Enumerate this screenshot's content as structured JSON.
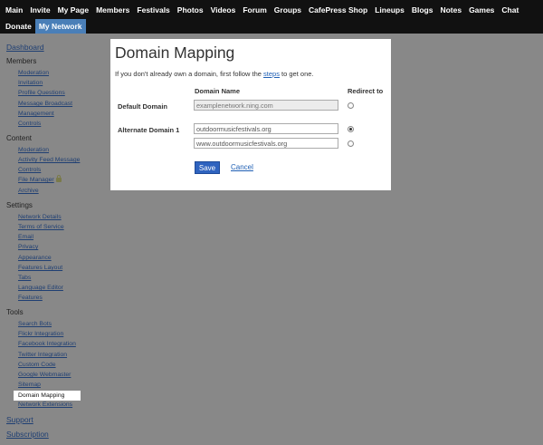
{
  "topnav": {
    "row1": [
      "Main",
      "Invite",
      "My Page",
      "Members",
      "Festivals",
      "Photos",
      "Videos",
      "Forum",
      "Groups",
      "CafePress Shop",
      "Lineups",
      "Blogs",
      "Notes",
      "Games",
      "Chat"
    ],
    "row2": [
      "Donate",
      "My Network"
    ],
    "active": "My Network"
  },
  "sidebar": {
    "dashboard": "Dashboard",
    "members": {
      "heading": "Members",
      "items": [
        "Moderation",
        "Invitation",
        "Profile Questions",
        "Message Broadcast",
        "Management",
        "Controls"
      ]
    },
    "content": {
      "heading": "Content",
      "items": [
        "Moderation",
        "Activity Feed Message",
        "Controls",
        "File Manager",
        "Archive"
      ]
    },
    "settings": {
      "heading": "Settings",
      "items": [
        "Network Details",
        "Terms of Service",
        "Email",
        "Privacy",
        "Appearance",
        "Features Layout",
        "Tabs",
        "Language Editor",
        "Features"
      ]
    },
    "tools": {
      "heading": "Tools",
      "items": [
        "Search Bots",
        "Flickr Integration",
        "Facebook Integration",
        "Twitter Integration",
        "Custom Code",
        "Google Webmaster",
        "Sitemap",
        "Domain Mapping",
        "Network Extensions"
      ],
      "selected": "Domain Mapping"
    },
    "support": "Support",
    "subscription": "Subscription"
  },
  "dialog": {
    "title": "Domain Mapping",
    "intro_before": "If you don't already own a domain, first follow the ",
    "intro_link": "steps",
    "intro_after": " to get one.",
    "col_domain": "Domain Name",
    "col_redirect": "Redirect to",
    "default_label": "Default Domain",
    "default_value": "examplenetwork.ning.com",
    "alternate_label": "Alternate Domain 1",
    "alternate_value_1": "outdoormusicfestivals.org",
    "alternate_value_2": "www.outdoormusicfestivals.org",
    "redirect_selected": "outdoormusicfestivals.org",
    "save": "Save",
    "cancel": "Cancel"
  },
  "colors": {
    "nav_bg": "#111111",
    "nav_active": "#4a7fb8",
    "overlay": "#888888",
    "primary_button": "#2f63bf",
    "link": "#1f3f73"
  }
}
